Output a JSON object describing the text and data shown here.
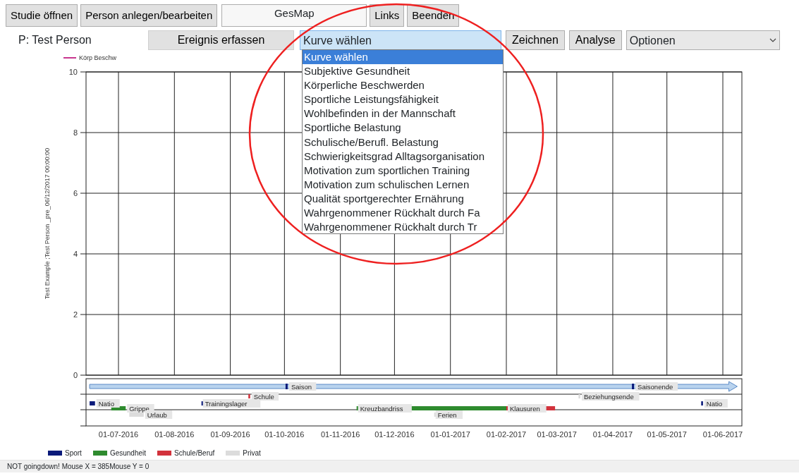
{
  "toolbar": {
    "buttons": [
      "Studie öffnen",
      "Person anlegen/bearbeiten"
    ],
    "title_field": "GesMap",
    "buttons_right": [
      "Links",
      "Beenden"
    ]
  },
  "person_label": "P: Test Person",
  "event_button": "Ereignis erfassen",
  "curve_select": {
    "value": "Kurve wählen",
    "expanded": true,
    "options": [
      {
        "label": "Kurve wählen",
        "selected": true
      },
      {
        "label": "Subjektive Gesundheit",
        "selected": false
      },
      {
        "label": "Körperliche Beschwerden",
        "selected": false
      },
      {
        "label": "Sportliche Leistungsfähigkeit",
        "selected": false
      },
      {
        "label": "Wohlbefinden in der Mannschaft",
        "selected": false
      },
      {
        "label": "Sportliche Belastung",
        "selected": false
      },
      {
        "label": "Schulische/Berufl. Belastung",
        "selected": false
      },
      {
        "label": "Schwierigkeitsgrad Alltagsorganisation",
        "selected": false
      },
      {
        "label": "Motivation zum sportlichen Training",
        "selected": false
      },
      {
        "label": "Motivation zum schulischen Lernen",
        "selected": false
      },
      {
        "label": "Qualität sportgerechter Ernährung",
        "selected": false
      },
      {
        "label": "Wahrgenommener Rückhalt durch Fa",
        "selected": false
      },
      {
        "label": "Wahrgenommener Rückhalt durch Tr",
        "selected": false
      }
    ]
  },
  "action_buttons": [
    "Zeichnen",
    "Analyse"
  ],
  "options_select": {
    "value": "Optionen"
  },
  "chart": {
    "chart_data": {
      "type": "line",
      "grid": true,
      "ylabel": "Test Example ;Test Person _pre_06/12/2017 00:00:00",
      "ylim": [
        0,
        10
      ],
      "yticks": [
        0,
        2,
        4,
        6,
        8,
        10
      ],
      "categories": [
        "01-07-2016",
        "01-08-2016",
        "01-09-2016",
        "01-10-2016",
        "01-11-2016",
        "01-12-2016",
        "01-01-2017",
        "01-02-2017",
        "01-03-2017",
        "01-04-2017",
        "01-05-2017",
        "01-06-2017"
      ],
      "series": [
        {
          "name": "Körp Beschw",
          "color": "#c8368f",
          "values": [
            null,
            null,
            null,
            null,
            null,
            null,
            null,
            null,
            null,
            null,
            null,
            null
          ]
        }
      ]
    },
    "events": [
      {
        "kind": "arrow",
        "color": "#b9d3ee"
      },
      {
        "kind": "marker",
        "label": "Saison",
        "color": "#0a1a7a"
      },
      {
        "kind": "marker",
        "label": "Saisonende",
        "color": "#0a1a7a"
      },
      {
        "kind": "bar",
        "label": "Natio",
        "color": "#0a1a7a"
      },
      {
        "kind": "bar",
        "label": "Grippe",
        "color": "#2e8b2e"
      },
      {
        "kind": "bar",
        "label": "Urlaub",
        "color": "#dcdcdc"
      },
      {
        "kind": "bar",
        "label": "Trainingslager",
        "color": "#0a1a7a"
      },
      {
        "kind": "bar",
        "label": "Schule",
        "color": "#d2323c"
      },
      {
        "kind": "bar",
        "label": "Kreuzbandriss",
        "color": "#2e8b2e"
      },
      {
        "kind": "bar",
        "label": "Ferien",
        "color": "#dcdcdc"
      },
      {
        "kind": "bar",
        "label": "Klausuren",
        "color": "#d2323c"
      },
      {
        "kind": "bar",
        "label": "Beziehungsende",
        "color": "#dcdcdc"
      },
      {
        "kind": "bar",
        "label": "Natio",
        "color": "#0a1a7a"
      }
    ]
  },
  "legend": [
    {
      "label": "Sport",
      "color": "#0a1a7a"
    },
    {
      "label": "Gesundheit",
      "color": "#2e8b2e"
    },
    {
      "label": "Schule/Beruf",
      "color": "#d2323c"
    },
    {
      "label": "Privat",
      "color": "#dcdcdc"
    }
  ],
  "status_bar": "NOT goingdown! Mouse X = 385Mouse Y = 0"
}
